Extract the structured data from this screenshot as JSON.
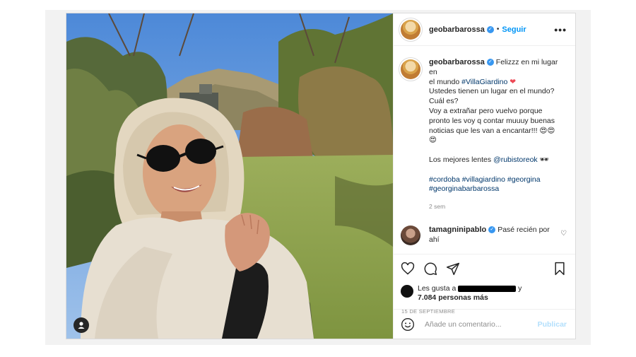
{
  "post": {
    "author": {
      "username": "geobarbarossa",
      "follow_label": "Seguir",
      "separator": "•",
      "more_label": "•••"
    },
    "caption": {
      "username": "geobarbarossa",
      "lines": [
        "Felizzz en mi lugar en",
        "el mundo",
        "Ustedes tienen un lugar en el mundo?",
        "Cuál es?",
        "Voy a extrañar pero vuelvo porque",
        "pronto les voy q contar muuuy buenas",
        "noticias que les van a encantar!!! 😍😍",
        "😍",
        "Los mejores lentes",
        "🕶"
      ],
      "hashtag_place": "#VillaGiardino",
      "heart": "❤",
      "mention": "@rubistoreok",
      "hashtags_line1": "#cordoba #villagiardino #georgina",
      "hashtags_line2": "#georginabarbarossa",
      "time": "2 sem"
    },
    "comment": {
      "username": "tamagninipablo",
      "text": "Pasé recién por",
      "text_cont": "ahí",
      "like_icon": "♡"
    },
    "likes": {
      "prefix": "Les gusta a",
      "suffix": "y",
      "count_text": "7.084 personas más"
    },
    "date": "15 DE SEPTIEMBRE",
    "add_comment": {
      "placeholder": "Añade un comentario...",
      "publish_label": "Publicar"
    },
    "colors": {
      "follow": "#0095f6",
      "link": "#00376b",
      "verified": "#3897f0",
      "publish_disabled": "#b2dffc"
    }
  }
}
